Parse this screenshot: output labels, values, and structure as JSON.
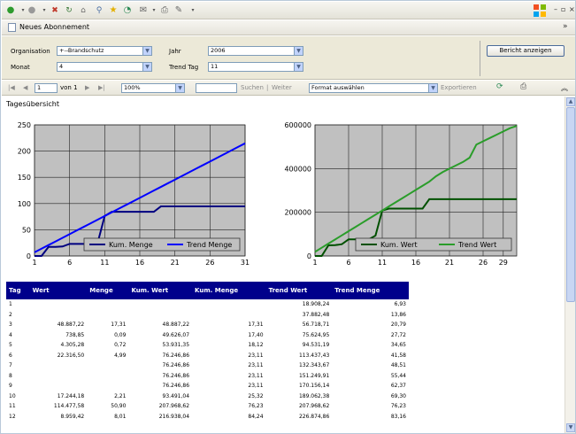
{
  "title_bar": {
    "title": "Neues Abonnement"
  },
  "parameters": {
    "organisation_label": "Organisation",
    "organisation_value": "+--Brandschutz",
    "monat_label": "Monat",
    "monat_value": "4",
    "jahr_label": "Jahr",
    "jahr_value": "2006",
    "trend_tag_label": "Trend Tag",
    "trend_tag_value": "11",
    "report_button": "Bericht anzeigen"
  },
  "navigation": {
    "page_current": "1",
    "page_of": "von 1",
    "zoom": "100%",
    "search_label": "Suchen",
    "next_label": "Weiter",
    "format": "Format auswählen",
    "export_label": "Exportieren"
  },
  "report": {
    "section_title": "Tagesübersicht"
  },
  "chart_data": [
    {
      "type": "line",
      "x": [
        1,
        2,
        3,
        4,
        5,
        6,
        7,
        8,
        9,
        10,
        11,
        12,
        13,
        14,
        15,
        16,
        17,
        18,
        19,
        20,
        21,
        22,
        23,
        24,
        25,
        26,
        27,
        28,
        29,
        30,
        31
      ],
      "xticks": [
        1,
        6,
        11,
        16,
        21,
        26,
        31
      ],
      "ylim": [
        0,
        250
      ],
      "yticks": [
        0,
        50,
        100,
        150,
        200,
        250
      ],
      "legend": "bottom-right",
      "series": [
        {
          "name": "Kum. Menge",
          "color": "#000080",
          "values": [
            0,
            0,
            17.31,
            17.4,
            18.12,
            23.11,
            23.11,
            23.11,
            23.11,
            25.32,
            76.23,
            84.24,
            84.24,
            84.24,
            84.24,
            84.24,
            84.24,
            84.24,
            94.5,
            94.5,
            94.5,
            94.5,
            94.5,
            94.5,
            94.5,
            94.5,
            94.5,
            94.5,
            94.5,
            94.5,
            94.5
          ]
        },
        {
          "name": "Trend Menge",
          "color": "#0000ff",
          "values": [
            6.93,
            13.86,
            20.79,
            27.72,
            34.65,
            41.58,
            48.51,
            55.44,
            62.37,
            69.3,
            76.23,
            83.16,
            90.09,
            97.02,
            103.95,
            110.88,
            117.81,
            124.74,
            131.67,
            138.6,
            145.53,
            152.46,
            159.39,
            166.32,
            173.25,
            180.18,
            187.11,
            194.04,
            200.97,
            207.9,
            214.83
          ]
        }
      ]
    },
    {
      "type": "line",
      "x": [
        1,
        2,
        3,
        4,
        5,
        6,
        7,
        8,
        9,
        10,
        11,
        12,
        13,
        14,
        15,
        16,
        17,
        18,
        19,
        20,
        21,
        22,
        23,
        24,
        25,
        26,
        27,
        28,
        29,
        30,
        31
      ],
      "xticks": [
        1,
        6,
        11,
        16,
        21,
        26,
        29
      ],
      "ylim": [
        0,
        600000
      ],
      "yticks": [
        0,
        200000,
        400000,
        600000
      ],
      "legend": "bottom-right",
      "series": [
        {
          "name": "Kum. Wert",
          "color": "#005000",
          "values": [
            0,
            0,
            48887.22,
            49626.07,
            53931.35,
            76246.86,
            76246.86,
            76246.86,
            76246.86,
            93491.04,
            207988.62,
            216938.04,
            216938.04,
            216938.04,
            216938.04,
            216938.04,
            216938.04,
            260000,
            260000,
            260000,
            260000,
            260000,
            260000,
            260000,
            260000,
            260000,
            260000,
            260000,
            260000,
            260000,
            260000
          ]
        },
        {
          "name": "Trend Wert",
          "color": "#2a9d2a",
          "values": [
            18908.24,
            37816.48,
            56718.71,
            75624.95,
            94531.19,
            113437.43,
            132343.67,
            151249.91,
            170156.14,
            189062.38,
            207968.62,
            226874.86,
            245781.1,
            264687.34,
            283593.58,
            302499.82,
            321406.06,
            340312.3,
            365000,
            384000,
            400000,
            415000,
            430000,
            450000,
            510000,
            525000,
            540000,
            555000,
            570000,
            585000,
            595000
          ]
        }
      ]
    }
  ],
  "table": {
    "headers": [
      "Tag",
      "Wert",
      "Menge",
      "Kum. Wert",
      "Kum. Menge",
      "Trend Wert",
      "Trend Menge"
    ],
    "rows": [
      [
        "1",
        "",
        "",
        "",
        "",
        "18.908,24",
        "6,93"
      ],
      [
        "2",
        "",
        "",
        "",
        "",
        "37.882,48",
        "13,86"
      ],
      [
        "3",
        "48.887,22",
        "17,31",
        "48.887,22",
        "17,31",
        "56.718,71",
        "20,79"
      ],
      [
        "4",
        "738,85",
        "0,09",
        "49.626,07",
        "17,40",
        "75.624,95",
        "27,72"
      ],
      [
        "5",
        "4.305,28",
        "0,72",
        "53.931,35",
        "18,12",
        "94.531,19",
        "34,65"
      ],
      [
        "6",
        "22.316,50",
        "4,99",
        "76.246,86",
        "23,11",
        "113.437,43",
        "41,58"
      ],
      [
        "7",
        "",
        "",
        "76.246,86",
        "23,11",
        "132.343,67",
        "48,51"
      ],
      [
        "8",
        "",
        "",
        "76.246,86",
        "23,11",
        "151.249,91",
        "55,44"
      ],
      [
        "9",
        "",
        "",
        "76.246,86",
        "23,11",
        "170.156,14",
        "62,37"
      ],
      [
        "10",
        "17.244,18",
        "2,21",
        "93.491,04",
        "25,32",
        "189.062,38",
        "69,30"
      ],
      [
        "11",
        "114.477,58",
        "50,90",
        "207.968,62",
        "76,23",
        "207.968,62",
        "76,23"
      ],
      [
        "12",
        "8.959,42",
        "8,01",
        "216.938,04",
        "84,24",
        "226.874,86",
        "83,16"
      ]
    ]
  }
}
